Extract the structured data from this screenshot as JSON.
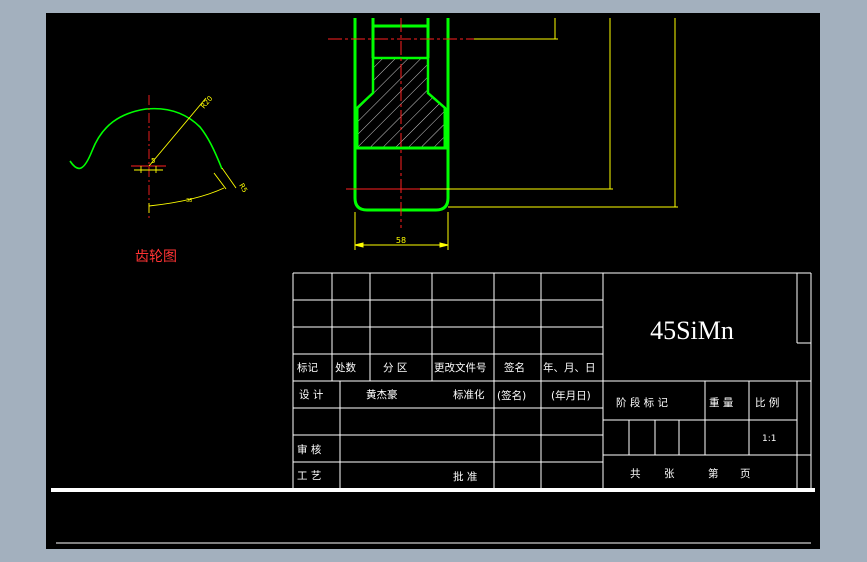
{
  "drawing": {
    "gear_profile_caption": "齿轮图",
    "dims": {
      "width_58": "58",
      "small_5": "5",
      "r20": "R20",
      "r5": "R5",
      "arc_label": "38"
    }
  },
  "title_block": {
    "material": "45SiMn",
    "headers": {
      "mark": "标记",
      "count": "处数",
      "zone": "分 区",
      "change_doc": "更改文件号",
      "signature": "签名",
      "date": "年、月、日"
    },
    "rows": {
      "design": "设 计",
      "designer_name": "黄杰豪",
      "standardize": "标准化",
      "sign_paren": "(签名)",
      "date_paren": "(年月日)",
      "review": "审 核",
      "process": "工 艺",
      "approve": "批 准"
    },
    "stage_mark": "阶 段 标 记",
    "weight": "重 量",
    "scale_label": "比 例",
    "scale_value": "1:1",
    "sheets_total": "共",
    "sheets_unit": "张",
    "sheet_no": "第",
    "page_unit": "页"
  },
  "colors": {
    "background": "#000000",
    "frame": "#ffffff",
    "outline": "#00ff00",
    "centerline": "#ff0000",
    "dimension": "#ffff00",
    "caption": "#ff3333"
  }
}
